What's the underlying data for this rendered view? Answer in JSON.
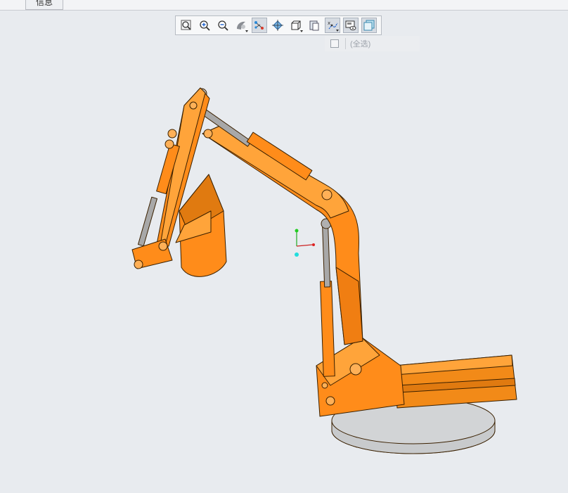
{
  "tabs": [
    {
      "label": "信息"
    }
  ],
  "toolbar": {
    "buttons": [
      {
        "name": "zoom-fit-icon",
        "active": false
      },
      {
        "name": "zoom-in-icon",
        "active": false
      },
      {
        "name": "zoom-out-icon",
        "active": false
      },
      {
        "name": "display-style-icon",
        "active": false
      },
      {
        "name": "datum-display-icon",
        "active": true
      },
      {
        "name": "spin-center-icon",
        "active": false
      },
      {
        "name": "saved-views-icon",
        "active": false
      },
      {
        "name": "view-manager-icon",
        "active": false
      },
      {
        "name": "annotation-display-icon",
        "active": true
      },
      {
        "name": "appearance-icon",
        "active": true
      },
      {
        "name": "visibility-filter-icon",
        "active": true
      }
    ]
  },
  "filter": {
    "select_all_label": "(全选)"
  },
  "colors": {
    "background": "#e8ebef",
    "model_orange": "#ff8c1a",
    "model_outline": "#3a2000",
    "base_gray": "#c8cacc",
    "cylinder_gray": "#a8a8a8"
  }
}
